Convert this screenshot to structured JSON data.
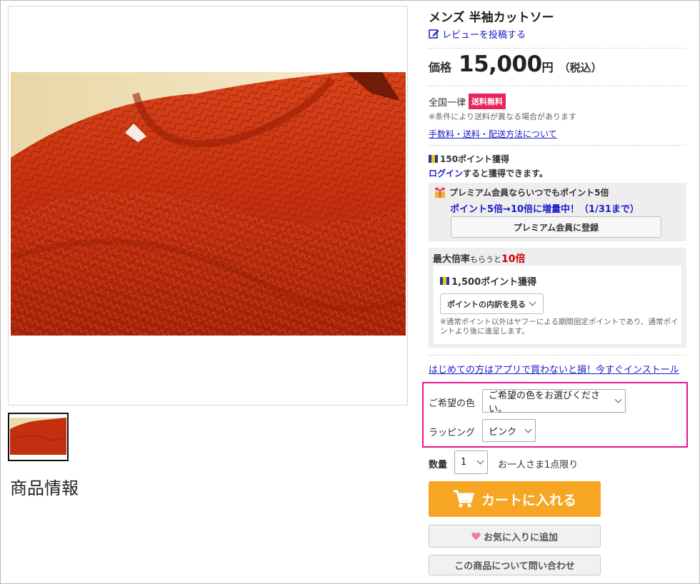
{
  "product": {
    "title": "メンズ 半袖カットソー",
    "review_link": "レビューを投稿する",
    "section_heading": "商品情報"
  },
  "price": {
    "label": "価格",
    "value": "15,000",
    "unit": "円",
    "tax": "（税込）"
  },
  "shipping": {
    "prefix": "全国一律",
    "badge": "送料無料",
    "note": "※条件により送料が異なる場合があります",
    "link": "手数料・送料・配送方法について"
  },
  "points": {
    "earned": "150ポイント獲得",
    "login_link": "ログイン",
    "login_suffix": "すると獲得できます。"
  },
  "premium": {
    "title": "プレミアム会員ならいつでもポイント5倍",
    "subtitle": "ポイント5倍→10倍に増量中！（1/31まで）",
    "register_button": "プレミアム会員に登録"
  },
  "max_rate": {
    "prefix": "最大倍率",
    "middle": "もらうと",
    "multiplier": "10倍",
    "points": "1,500ポイント獲得",
    "breakdown_button": "ポイントの内訳を見る",
    "note": "※通常ポイント以外はヤフーによる期間固定ポイントであり、通常ポイントより後に進呈します。"
  },
  "app_link": "はじめての方はアプリで買わないと損！今すぐインストール",
  "options": {
    "color_label": "ご希望の色",
    "color_value": "ご希望の色をお選びください。",
    "wrapping_label": "ラッピング",
    "wrapping_value": "ピンク"
  },
  "quantity": {
    "label": "数量",
    "value": "1",
    "note": "お一人さま1点限り"
  },
  "buttons": {
    "cart": "カートに入れる",
    "favorite": "お気に入りに追加",
    "inquiry": "この商品について問い合わせ"
  },
  "colors": {
    "accent_pink": "#e4178d",
    "badge_red": "#e6265a",
    "cart_orange": "#f6a623",
    "link_blue": "#1a1acc",
    "sweater": "#c8300f"
  },
  "icons": {
    "review": "pencil-edit-icon",
    "tpoint": "tpoint-icon",
    "gift": "gift-icon",
    "cart": "shopping-cart-icon",
    "heart": "heart-icon",
    "chevron": "chevron-down-icon"
  }
}
